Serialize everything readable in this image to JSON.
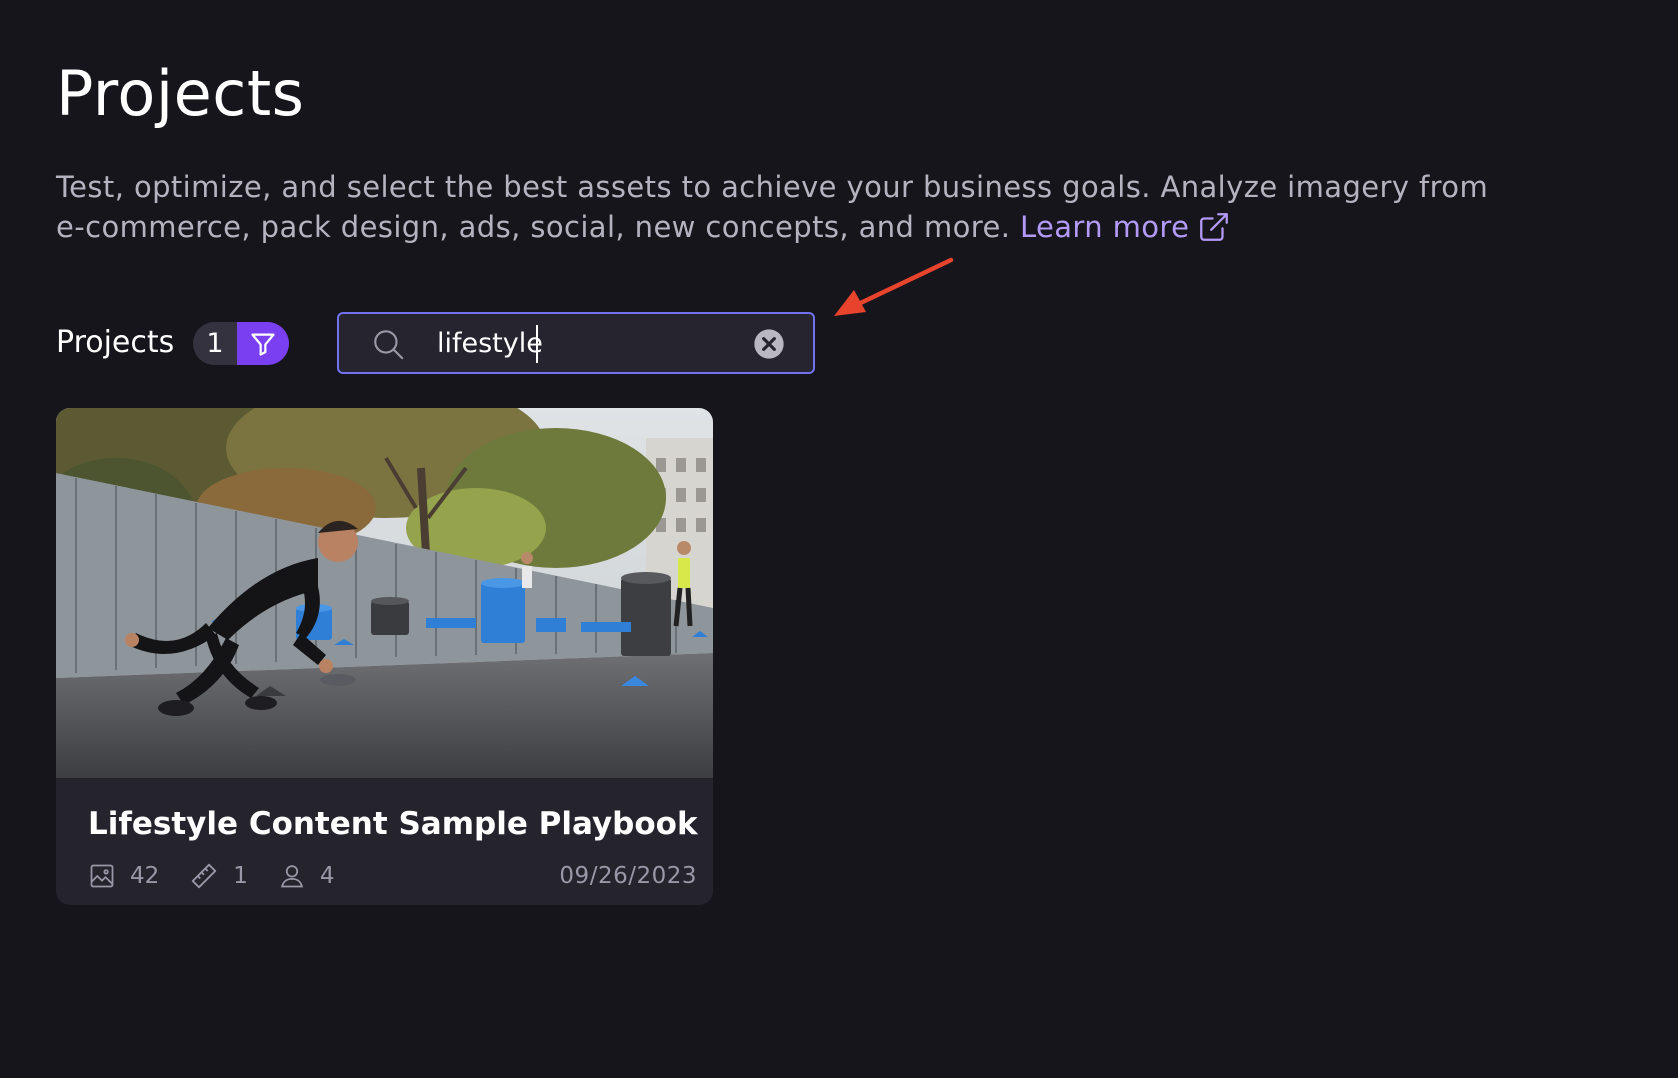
{
  "header": {
    "title": "Projects",
    "description": "Test, optimize, and select the best assets to achieve your business goals. Analyze imagery from e-commerce, pack design, ads, social, new concepts, and more.",
    "learn_more_label": "Learn more",
    "link_color": "#b49af7"
  },
  "toolbar": {
    "label": "Projects",
    "count": "1",
    "filter_color": "#7b3ff2",
    "filter_icon": "filter-icon"
  },
  "search": {
    "value": "lifestyle",
    "search_icon": "search-icon",
    "clear_icon": "close-circle-icon",
    "border_color": "#7272ee"
  },
  "annotation": {
    "arrow_color": "#e8432d",
    "arrow_icon": "arrow-icon"
  },
  "projects": [
    {
      "title": "Lifestyle Content Sample Playbook",
      "images": "42",
      "metrics": "1",
      "members": "4",
      "date": "09/26/2023",
      "image_icon": "image-icon",
      "ruler_icon": "ruler-icon",
      "user_icon": "user-icon"
    }
  ]
}
